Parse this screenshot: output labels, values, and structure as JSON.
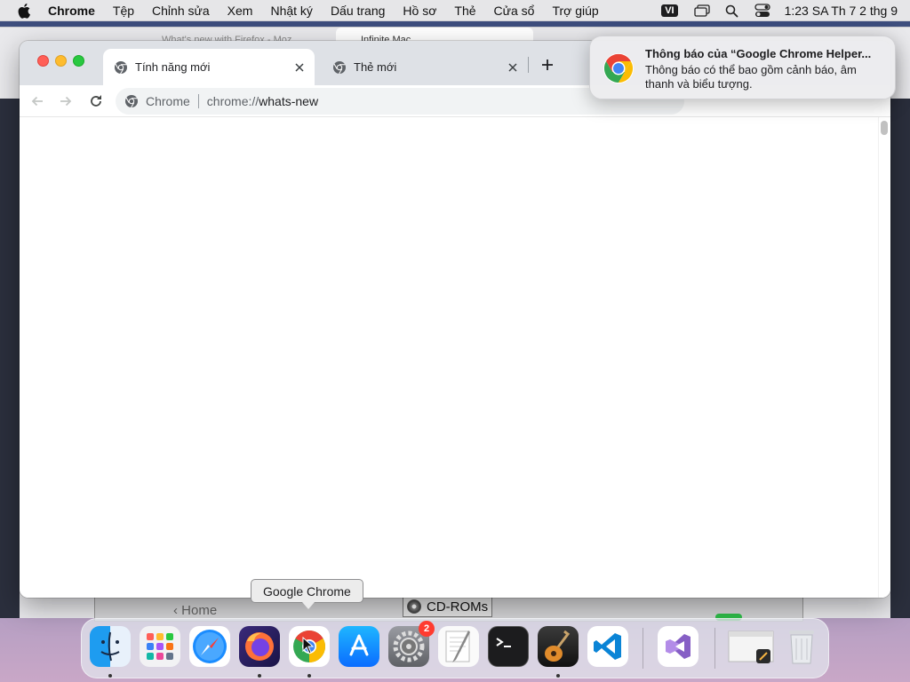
{
  "menubar": {
    "app_name": "Chrome",
    "items": [
      "Tệp",
      "Chỉnh sửa",
      "Xem",
      "Nhật ký",
      "Dấu trang",
      "Hồ sơ",
      "Thẻ",
      "Cửa sổ",
      "Trợ giúp"
    ],
    "input_language": "VI",
    "clock": "1:23 SA Th 7 2 thg 9"
  },
  "background": {
    "tab1_title": "What's new with Firefox - Moz",
    "tab2_title": "Infinite Mac"
  },
  "back_window": {
    "home_label": "‹ Home",
    "cdrom_label": "CD-ROMs"
  },
  "chrome": {
    "tabs": [
      {
        "title": "Tính năng mới",
        "active": true
      },
      {
        "title": "Thẻ mới",
        "active": false
      }
    ],
    "omnibox": {
      "site_chip": "Chrome",
      "url_scheme": "chrome://",
      "url_host": "whats-new"
    }
  },
  "notification": {
    "title": "Thông báo của “Google Chrome Helper...",
    "body": "Thông báo có thể bao gồm cảnh báo, âm thanh và biểu tượng."
  },
  "tooltip": {
    "label": "Google Chrome"
  },
  "dock": {
    "apps": [
      {
        "name": "Finder",
        "icon": "finder-icon",
        "running": true
      },
      {
        "name": "Launchpad",
        "icon": "launchpad-icon",
        "running": false
      },
      {
        "name": "Safari",
        "icon": "safari-icon",
        "running": false
      },
      {
        "name": "Firefox",
        "icon": "firefox-icon",
        "running": true
      },
      {
        "name": "Google Chrome",
        "icon": "chrome-icon",
        "running": true
      },
      {
        "name": "App Store",
        "icon": "app-store-icon",
        "running": false
      },
      {
        "name": "System Preferences",
        "icon": "system-preferences-icon",
        "running": false,
        "badge": "2"
      },
      {
        "name": "TextEdit",
        "icon": "textedit-icon",
        "running": false
      },
      {
        "name": "Terminal",
        "icon": "terminal-icon",
        "running": false
      },
      {
        "name": "GarageBand",
        "icon": "garageband-icon",
        "running": true
      },
      {
        "name": "Visual Studio Code",
        "icon": "vscode-icon",
        "running": false
      },
      {
        "name": "Visual Studio",
        "icon": "visual-studio-icon",
        "running": false
      },
      {
        "name": "Preview",
        "icon": "preview-icon",
        "running": false
      },
      {
        "name": "Trash",
        "icon": "trash-icon",
        "running": false
      }
    ]
  },
  "colors": {
    "chrome_tabstrip": "#dee1e6",
    "omnibox_bg": "#f1f3f4",
    "badge_red": "#ff3b30"
  }
}
